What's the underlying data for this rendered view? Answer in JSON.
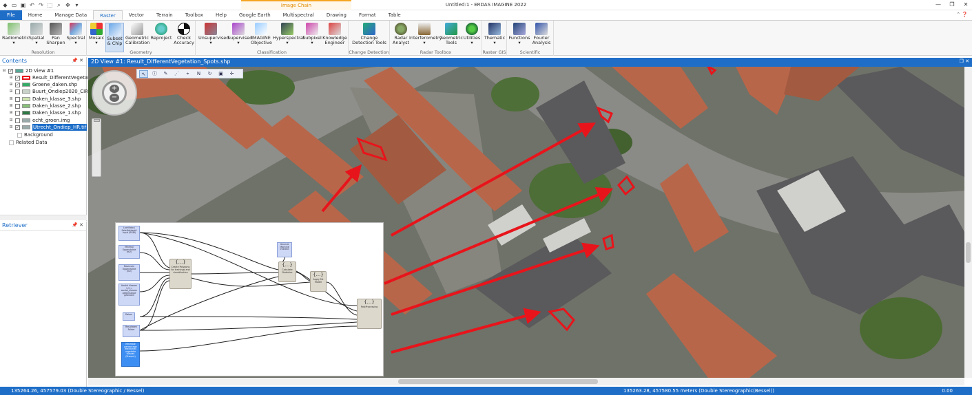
{
  "app": {
    "title": "Untitled:1 - ERDAS IMAGINE 2022",
    "context_tab": "Image Chain"
  },
  "ribbon_tabs": [
    "File",
    "Home",
    "Manage Data",
    "Raster",
    "Vector",
    "Terrain",
    "Toolbox",
    "Help",
    "Google Earth",
    "Multispectral",
    "Drawing",
    "Format",
    "Table"
  ],
  "groups": {
    "resolution": "Resolution",
    "geometry": "Geometry",
    "classification": "Classification",
    "change_detection": "Change Detection",
    "radar": "Radar Toolbox",
    "raster_gis": "Raster GIS",
    "scientific": "Scientific"
  },
  "buttons": {
    "radiometric": "Radiometric",
    "spatial": "Spatial",
    "pan_sharpen": "Pan Sharpen",
    "spectral": "Spectral",
    "mosaic": "Mosaic",
    "subset": "Subset & Chip",
    "geometric": "Geometric Calibration",
    "reproject": "Reproject",
    "check_accuracy": "Check Accuracy",
    "unsupervised": "Unsupervised",
    "supervised": "Supervised",
    "imagine_objective": "IMAGINE Objective",
    "hyperspectral": "Hyperspectral",
    "subpixel": "Subpixel",
    "knowledge_engineer": "Knowledge Engineer",
    "change_detection_tools": "Change Detection Tools",
    "radar_analyst": "Radar Analyst",
    "interferometry": "Interferometry",
    "geometric_tools": "Geometric Tools",
    "utilities": "Utilities",
    "thematic": "Thematic",
    "functions": "Functions",
    "fourier": "Fourier Analysis"
  },
  "contents": {
    "title": "Contents",
    "items": [
      "2D View #1",
      "Result_DifferentVegetation_Spots.shp",
      "Groene_daken.shp",
      "Buurt_Ondiep2020_CIR.ecw",
      "Daken_klasse_3.shp",
      "Daken_klasse_2.shp",
      "Daken_klasse_1.shp",
      "echt_groen.img",
      "Utrecht_Ondiep_HR.tif",
      "Background",
      "Related Data"
    ]
  },
  "retriever": {
    "title": "Retriever"
  },
  "view": {
    "title": "2D View #1: Result_DifferentVegetation_Spots.shp"
  },
  "diagram": {
    "inputs": [
      "Luchtfoto / Satellietbeeld Input (RGBI)",
      "Minimal Oppervlakte (m2)",
      "Maximale Oppervlakte (m2)",
      "Aantal klassen 1-5 = aantal_klassen gelijkmatige gebieden",
      "Daken",
      "Resultaten Folder",
      "Minimale percentage (fractional) vegetatie klasses (Procent)",
      "General Machine Intellect"
    ],
    "ops": [
      "Create Polygons for trainings and classification",
      "Calculate Statistics",
      "Apply ML Model",
      "PostProcessing"
    ]
  },
  "status": {
    "left": "135264.26, 457579.03   (Double Stereographic / Bessel)",
    "mid": "135263.28, 457580.55 meters (Double Stereographic(Bessel))",
    "right": "0.00"
  },
  "colors": {
    "accent": "#1e6ec8",
    "annotation": "#e8141b",
    "context": "#f5a623"
  }
}
